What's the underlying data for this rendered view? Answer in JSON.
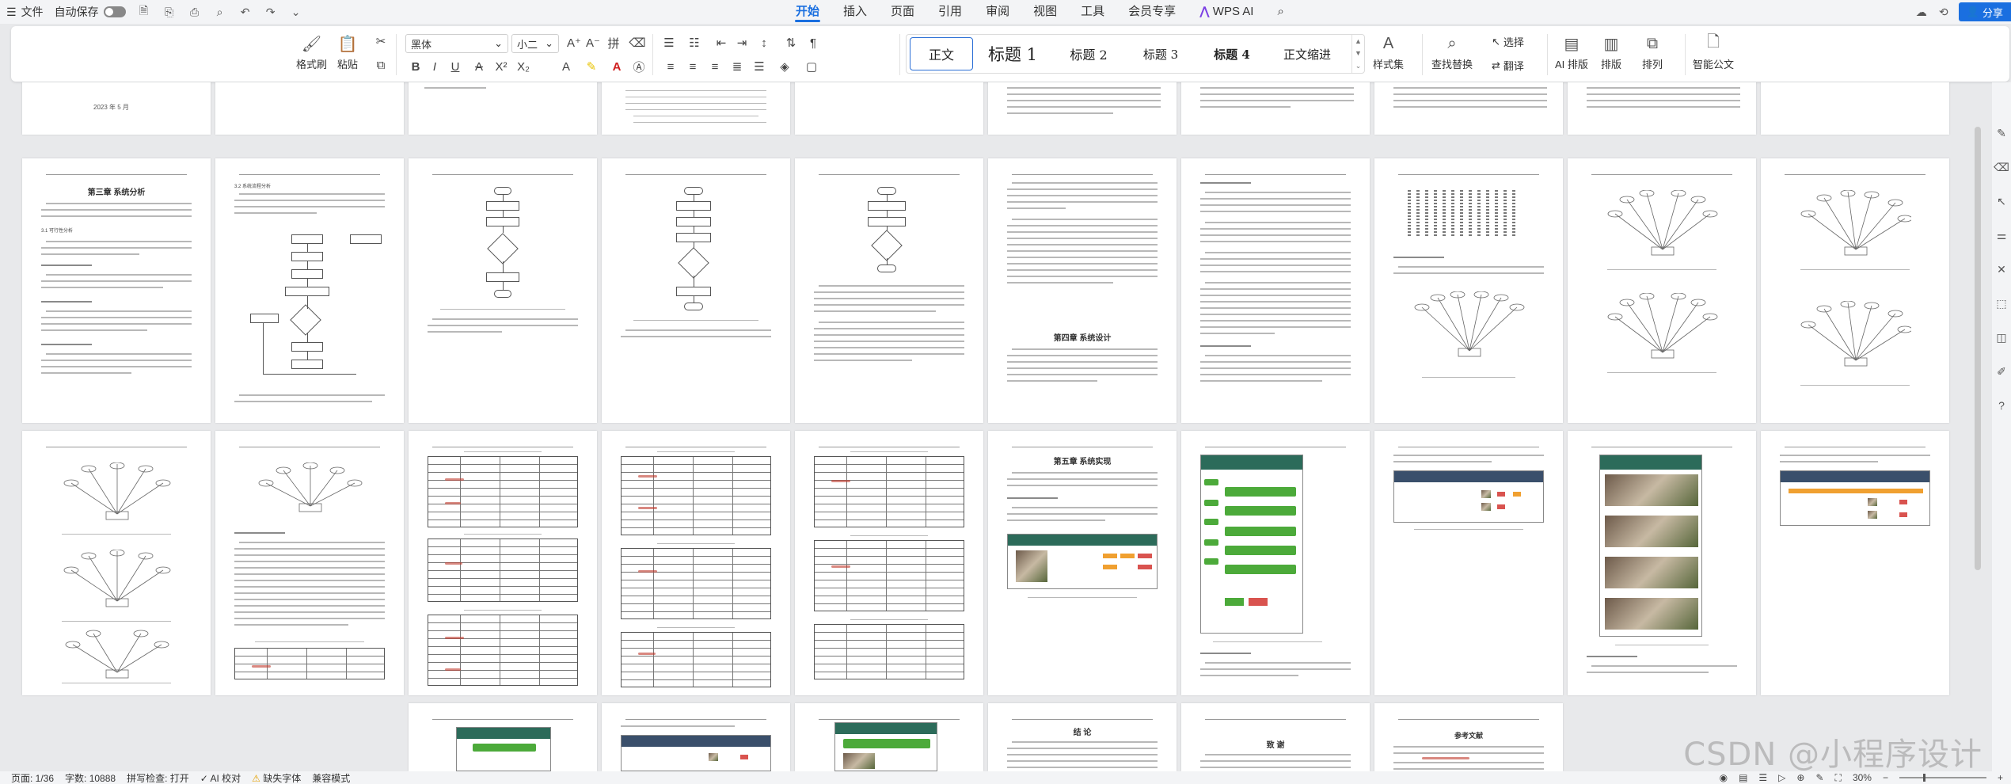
{
  "titlebar": {
    "file_menu": "文件",
    "autosave_label": "自动保存",
    "tabs": [
      "开始",
      "插入",
      "页面",
      "引用",
      "审阅",
      "视图",
      "工具",
      "会员专享",
      "WPS AI"
    ],
    "share_label": "分享"
  },
  "ribbon": {
    "format_painter": "格式刷",
    "paste": "粘贴",
    "font_name": "黑体",
    "font_size": "小二",
    "styles": [
      "正文",
      "标题 1",
      "标题 2",
      "标题 3",
      "标题 4",
      "正文缩进"
    ],
    "style_set": "样式集",
    "find_replace": "查找替换",
    "select": "选择",
    "translate": "翻译",
    "ai_layout": "AI 排版",
    "layout": "排版",
    "arrange": "排列",
    "smart_doc": "智能公文"
  },
  "document": {
    "cover_date": "2023 年 5 月",
    "ch3_title": "第三章  系统分析",
    "ch3_sec1": "3.1 可行性分析",
    "ch3_sec2": "3.2 系统流程分析",
    "ch4_title": "第四章  系统设计",
    "ch5_title": "第五章  系统实现",
    "conclusion_title": "结  论",
    "thanks_title": "致  谢",
    "ref_title": "参考文献"
  },
  "statusbar": {
    "page": "页面: 1/36",
    "words": "字数: 10888",
    "spell_check": "拼写检查: 打开",
    "ai_check": "AI 校对",
    "missing_font": "缺失字体",
    "compat_mode": "兼容模式",
    "zoom": "30%"
  },
  "watermark": "CSDN @小程序设计"
}
